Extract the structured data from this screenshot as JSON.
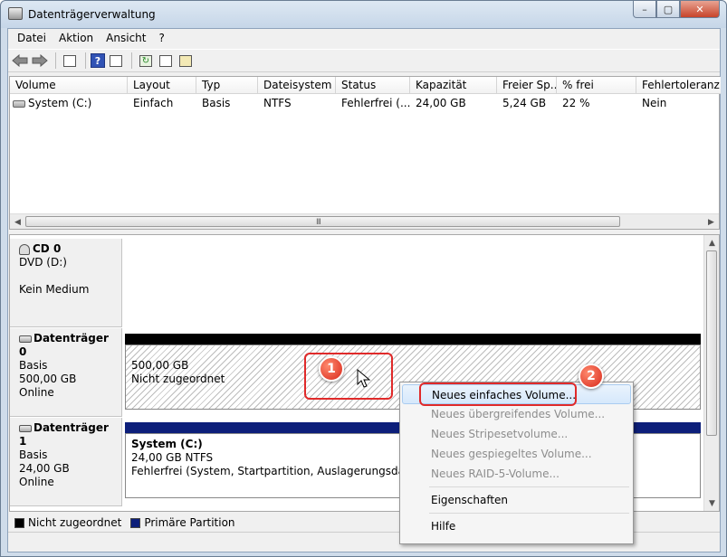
{
  "window": {
    "title": "Datenträgerverwaltung",
    "buttons": {
      "minimize": "–",
      "maximize": "▢",
      "close": "✕"
    }
  },
  "menubar": [
    "Datei",
    "Aktion",
    "Ansicht",
    "?"
  ],
  "toolbar": {
    "icons": [
      "back-arrow-icon",
      "forward-arrow-icon",
      "console-tree-icon",
      "help-icon",
      "properties-view-icon",
      "refresh-icon",
      "properties-icon",
      "disk-rescan-icon"
    ],
    "help_label": "?"
  },
  "volume_list": {
    "columns": [
      "Volume",
      "Layout",
      "Typ",
      "Dateisystem",
      "Status",
      "Kapazität",
      "Freier Sp...",
      "% frei",
      "Fehlertoleranz"
    ],
    "rows": [
      [
        "System (C:)",
        "Einfach",
        "Basis",
        "NTFS",
        "Fehlerfrei (...",
        "24,00 GB",
        "5,24 GB",
        "22 %",
        "Nein"
      ]
    ],
    "scroll_grip": "III"
  },
  "disks": [
    {
      "name": "CD 0",
      "type": "DVD (D:)",
      "size": "",
      "status": "Kein Medium"
    },
    {
      "name": "Datenträger 0",
      "type": "Basis",
      "size": "500,00 GB",
      "status": "Online",
      "partition": {
        "kind": "unalloc",
        "size": "500,00 GB",
        "label": "Nicht zugeordnet"
      }
    },
    {
      "name": "Datenträger 1",
      "type": "Basis",
      "size": "24,00 GB",
      "status": "Online",
      "partition": {
        "kind": "primary",
        "title": "System  (C:)",
        "fs": "24,00 GB NTFS",
        "status": "Fehlerfrei (System, Startpartition, Auslagerungsdatei, Akti"
      }
    }
  ],
  "legend": [
    {
      "label": "Nicht zugeordnet",
      "color": "#000000"
    },
    {
      "label": "Primäre Partition",
      "color": "#0d1f7a"
    }
  ],
  "annotations": {
    "step1": "1",
    "step2": "2"
  },
  "context_menu": {
    "items": [
      {
        "label": "Neues einfaches Volume...",
        "enabled": true,
        "highlighted": true
      },
      {
        "label": "Neues übergreifendes Volume...",
        "enabled": false
      },
      {
        "label": "Neues Stripesetvolume...",
        "enabled": false
      },
      {
        "label": "Neues gespiegeltes Volume...",
        "enabled": false
      },
      {
        "label": "Neues RAID-5-Volume...",
        "enabled": false
      },
      {
        "separator": true
      },
      {
        "label": "Eigenschaften",
        "enabled": true
      },
      {
        "separator": true
      },
      {
        "label": "Hilfe",
        "enabled": true
      }
    ]
  }
}
